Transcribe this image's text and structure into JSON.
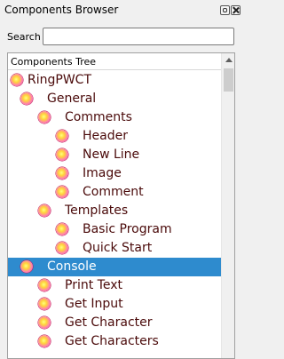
{
  "window": {
    "title": "Components Browser",
    "float_icon": "float-icon",
    "close_icon": "close-icon"
  },
  "search": {
    "label": "Search",
    "value": "",
    "placeholder": ""
  },
  "tree": {
    "header": "Components Tree",
    "rows": [
      {
        "label": "RingPWCT",
        "level": 0,
        "selected": false
      },
      {
        "label": "General",
        "level": 1,
        "selected": false
      },
      {
        "label": "Comments",
        "level": 2,
        "selected": false
      },
      {
        "label": "Header",
        "level": 3,
        "selected": false
      },
      {
        "label": "New Line",
        "level": 3,
        "selected": false
      },
      {
        "label": "Image",
        "level": 3,
        "selected": false
      },
      {
        "label": "Comment",
        "level": 3,
        "selected": false
      },
      {
        "label": "Templates",
        "level": 2,
        "selected": false
      },
      {
        "label": "Basic Program",
        "level": 3,
        "selected": false
      },
      {
        "label": "Quick Start",
        "level": 3,
        "selected": false
      },
      {
        "label": "Console",
        "level": 1,
        "selected": true
      },
      {
        "label": "Print Text",
        "level": 2,
        "selected": false
      },
      {
        "label": "Get Input",
        "level": 2,
        "selected": false
      },
      {
        "label": "Get Character",
        "level": 2,
        "selected": false
      },
      {
        "label": "Get Characters",
        "level": 2,
        "selected": false
      }
    ]
  },
  "colors": {
    "selection": "#2e8bce",
    "text": "#4a0a0a"
  }
}
